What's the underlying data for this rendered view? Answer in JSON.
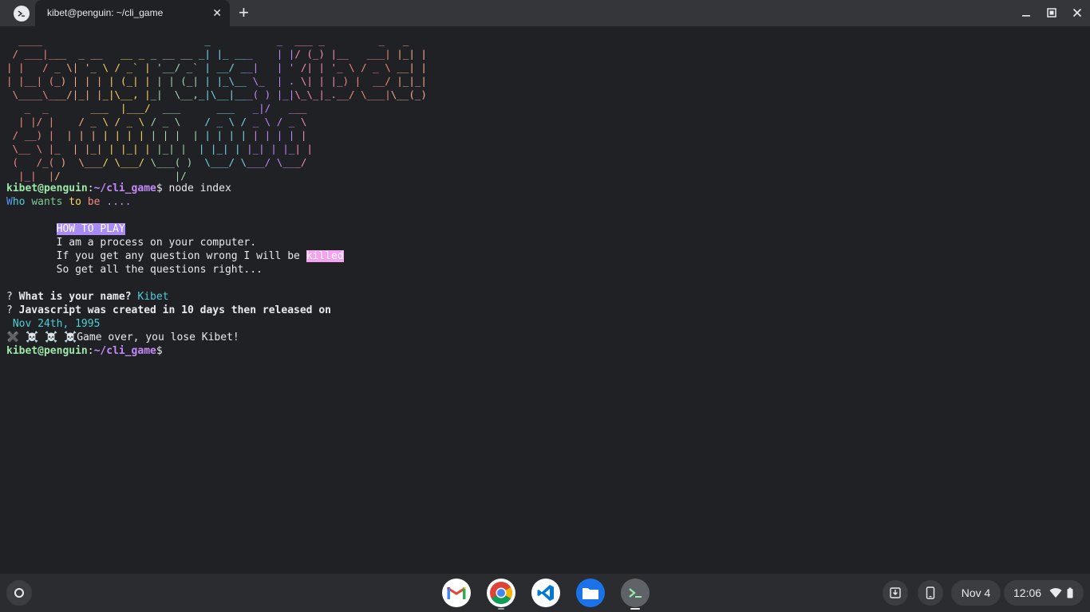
{
  "window": {
    "tab_title": "kibet@penguin: ~/cli_game",
    "close_tab_glyph": "✕",
    "new_tab_glyph": "+",
    "app_icon": "terminal-icon"
  },
  "terminal": {
    "ascii_art": [
      "  ____                           _           _  ___ _         _   _ ",
      " / ___|___  _ __   __ _ _ __ __ _| |_ ___    | |/ (_) |__   ___| |_| |",
      "| |   / _ \\| '_ \\ / _` | '__/ _` | __/ __|   | ' /| | '_ \\ / _ \\ __| |",
      "| |__| (_) | | | | (_| | | | (_| | |_\\__ \\_  | . \\| | |_) |  __/ |_|_|",
      " \\____\\___/|_| |_|\\__, |_|  \\__,_|\\__|___( ) |_|\\_\\_|_.__/ \\___|\\__(_)",
      "   _  _       ___  |___/  ___      ___   _|/   ___  ",
      "  | |/ |    / _ \\ / _ \\ / _ \\    / _ \\ / _ \\ / _ \\ ",
      " / __) |  | | | | | | | | | |  | | | | | | | | | |",
      " \\__ \\ |_  | |_| | |_| | |_| |  | |_| | |_| | |_| |",
      " (   /_( )  \\___/ \\___/ \\___( )  \\___/ \\___/ \\___/ ",
      "  |_|  |/                   |/                     "
    ],
    "art_colors": [
      "#f28b82",
      "#f6ae8a",
      "#fdd663",
      "#a8dab5",
      "#78d9ec",
      "#c58af9",
      "#f48fb1"
    ],
    "prompt_user": "kibet@penguin",
    "prompt_sep": ":",
    "prompt_path": "~/cli_game",
    "prompt_dollar": "$",
    "command": " node index",
    "rainbow_line": [
      {
        "text": "W",
        "color": "#5b8ff9"
      },
      {
        "text": "ho ",
        "color": "#4ecdd6"
      },
      {
        "text": "wants ",
        "color": "#81c995"
      },
      {
        "text": "to ",
        "color": "#fdd663"
      },
      {
        "text": "be ",
        "color": "#f28b82"
      },
      {
        "text": "....",
        "color": "#c58af9"
      }
    ],
    "how_to_play": "HOW TO PLAY",
    "info_1": "I am a process on your computer.",
    "info_2_prefix": "If you get any question wrong I will be ",
    "info_2_highlight": "killed",
    "info_3": "So get all the questions right...",
    "q_mark": "?",
    "q1": "What is your name?",
    "a1": "Kibet",
    "q2": "Javascript was created in 10 days then released on",
    "a2": "Nov 24th, 1995",
    "lose_icons": "✖️ ☠️ ☠️ ☠️",
    "lose_text": "Game over, you lose Kibet!"
  },
  "shelf": {
    "apps": [
      {
        "name": "gmail-icon",
        "color": "#ffffff"
      },
      {
        "name": "chrome-icon",
        "color": "#ffffff"
      },
      {
        "name": "vscode-icon",
        "color": "#ffffff"
      },
      {
        "name": "files-icon",
        "color": "#1a73e8"
      },
      {
        "name": "terminal-icon",
        "color": "#5f6368"
      }
    ],
    "date": "Nov 4",
    "time": "12:06"
  }
}
